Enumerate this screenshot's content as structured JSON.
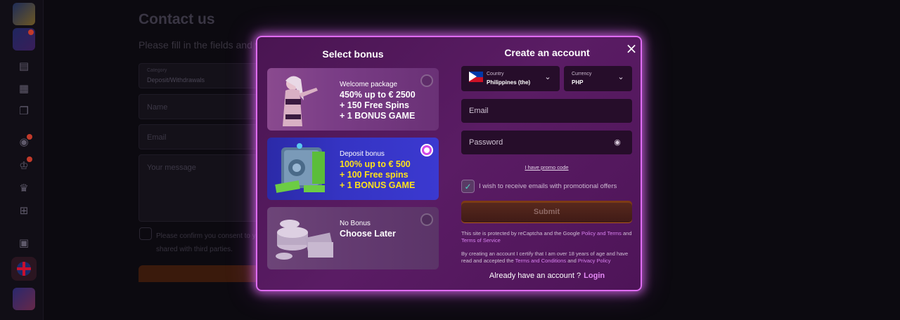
{
  "background": {
    "title": "Contact us",
    "subtitle": "Please fill in the fields and w",
    "category_label": "Category",
    "category_value": "Deposit/Withdrawals",
    "name_placeholder": "Name",
    "email_placeholder": "Email",
    "message_placeholder": "Your message",
    "consent_line1": "Please confirm you consent to yo",
    "consent_line2": "shared with third parties."
  },
  "sidebar": {
    "icons": [
      "game-thumb-1",
      "game-thumb-2",
      "ticket-icon",
      "gift-icon",
      "copy-icon",
      "medal-icon",
      "trophy-icon",
      "crown-icon",
      "tree-icon",
      "chat-icon",
      "flag-uk-icon",
      "game-thumb-3"
    ]
  },
  "modal": {
    "close_glyph": "×",
    "select_bonus": {
      "title": "Select bonus",
      "options": [
        {
          "name": "Welcome package",
          "lines": [
            "450% up to € 2500",
            "+ 150 Free Spins",
            "+ 1 BONUS GAME"
          ],
          "selected": false
        },
        {
          "name": "Deposit bonus",
          "lines": [
            "100% up to € 500",
            "+ 100 Free spins",
            "+ 1 BONUS GAME"
          ],
          "selected": true
        },
        {
          "name": "No Bonus",
          "lines": [
            "Choose Later"
          ],
          "selected": false
        }
      ]
    },
    "create_account": {
      "title": "Create an account",
      "country_label": "Country",
      "country_value": "Philippines (the)",
      "currency_label": "Currency",
      "currency_value": "PHP",
      "email_placeholder": "Email",
      "password_placeholder": "Password",
      "promo_link": "I have promo code",
      "promo_checkbox_label": "I wish to receive emails with promotional offers",
      "promo_checked": true,
      "submit_label": "Submit",
      "recaptcha_text": "This site is protected by reCaptcha and the Google ",
      "policy_terms_link": "Policy and Terms",
      "and1": " and ",
      "terms_service_link": "Terms of Service",
      "age_text": "By creating an account I certify that I am over 18 years of age and have read and accepted the ",
      "terms_conditions_link": "Terms and Conditions",
      "and2": " and ",
      "privacy_link": "Privacy Policy",
      "already_text": "Already have an account ?",
      "login_link": "Login"
    }
  },
  "colors": {
    "modal_border": "#e06cf4",
    "accent_link": "#d880f0",
    "bonus_highlight": "#ffe21a",
    "selected_radio": "#d24ae8"
  }
}
